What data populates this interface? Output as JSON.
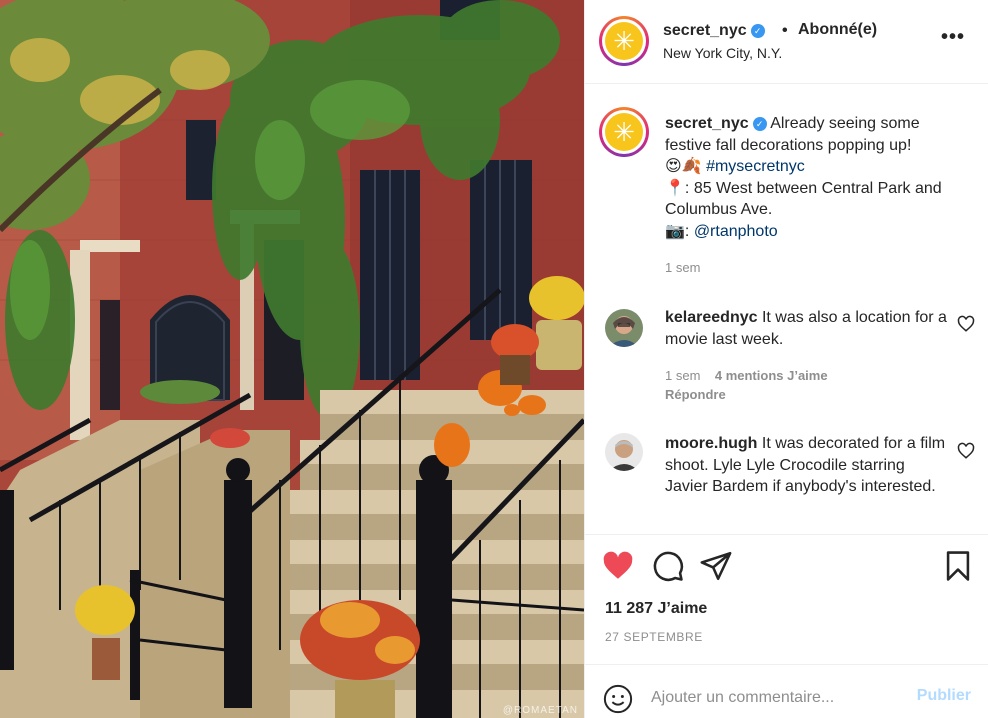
{
  "post": {
    "image_alt": "",
    "watermark": "@ROMAETAN"
  },
  "header": {
    "username": "secret_nyc",
    "verified": "✓",
    "separator": "•",
    "follow_status": "Abonné(e)",
    "location": "New York City, N.Y.",
    "more_icon": "•••",
    "avatar_glyph": "✳"
  },
  "caption": {
    "username": "secret_nyc",
    "line1": "Already seeing some festive fall decorations popping up!",
    "emojis": "😍🍂",
    "hashtag": "#mysecretnyc",
    "pin": "📍",
    "address": ": 85 West between Central Park and Columbus Ave.",
    "camera": "📷",
    "credit_sep": ": ",
    "credit_handle": "@rtanphoto",
    "time": "1 sem"
  },
  "comments": [
    {
      "username": "kelareednyc",
      "text": "It was also a location for a movie last week.",
      "time": "1 sem",
      "likes": "4 mentions J’aime",
      "reply": "Répondre"
    },
    {
      "username": "moore.hugh",
      "text": "It was decorated for a film shoot. Lyle Lyle Crocodile starring Javier Bardem if anybody's interested."
    }
  ],
  "engagement": {
    "likes": "11 287 J’aime",
    "date": "27 SEPTEMBRE"
  },
  "composer": {
    "placeholder": "Ajouter un commentaire...",
    "post_label": "Publier"
  },
  "colors": {
    "heart": "#ed4956",
    "link": "#00376b",
    "post_disabled": "#b3dbff",
    "verified": "#3897f0"
  }
}
